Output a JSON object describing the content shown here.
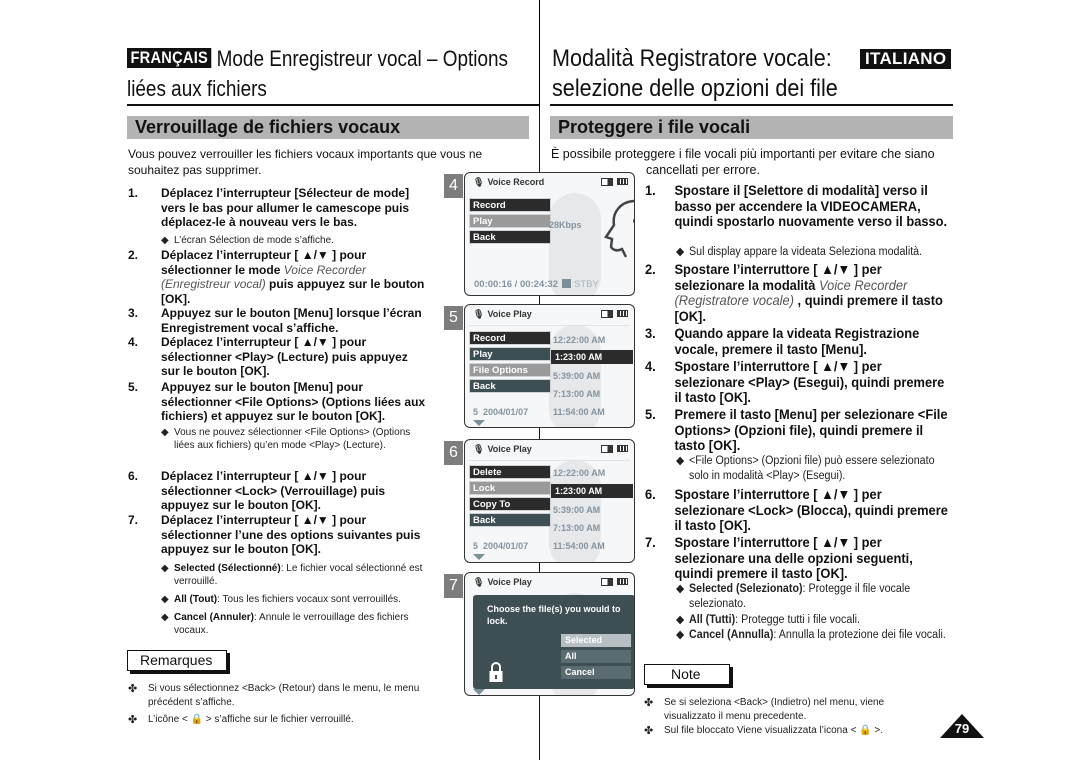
{
  "header": {
    "fr_badge": "FRANÇAIS",
    "fr_title_line1": "Mode Enregistreur vocal – Options",
    "fr_title_line2": "liées aux fichiers",
    "it_title_line1": "Modalità Registratore vocale:",
    "it_title_line2": "selezione delle opzioni dei file",
    "it_badge": "ITALIANO"
  },
  "french": {
    "section_title": "Verrouillage de fichiers vocaux",
    "intro": "Vous pouvez verrouiller les fichiers vocaux importants que vous ne souhaitez pas supprimer.",
    "steps": [
      {
        "num": "1.",
        "text": "Déplacez l’interrupteur [Sélecteur de mode] vers le bas pour allumer le camescope puis déplacez-le à nouveau vers le bas."
      },
      {
        "num": "2.",
        "text_a": "Déplacez l’interrupteur [ ▲/▼ ] pour sélectionner le mode ",
        "text_it": "Voice Recorder (Enregistreur vocal)",
        "text_b": " puis appuyez sur le bouton [OK]."
      },
      {
        "num": "3.",
        "text": "Appuyez sur le bouton [Menu] lorsque l’écran Enregistrement vocal s’affiche."
      },
      {
        "num": "4.",
        "text": "Déplacez l’interrupteur [ ▲/▼ ] pour sélectionner <Play> (Lecture) puis appuyez sur le bouton [OK]."
      },
      {
        "num": "5.",
        "text": "Appuyez sur le bouton [Menu] pour sélectionner <File Options> (Options liées aux fichiers) et appuyez sur le bouton [OK]."
      },
      {
        "num": "6.",
        "text": "Déplacez l’interrupteur [ ▲/▼ ] pour sélectionner <Lock> (Verrouillage) puis appuyez sur le bouton [OK]."
      },
      {
        "num": "7.",
        "text": "Déplacez l’interrupteur [ ▲/▼ ] pour sélectionner l’une des options suivantes puis appuyez sur le bouton [OK]."
      }
    ],
    "bullets": {
      "after_1": "L’écran Sélection de mode s’affiche.",
      "after_5": "Vous ne pouvez sélectionner <File Options> (Options liées aux fichiers) qu’en mode <Play> (Lecture).",
      "options": [
        {
          "term": "Selected (Sélectionné)",
          "desc": ": Le fichier vocal sélectionné est verrouillé."
        },
        {
          "term": "All (Tout)",
          "desc": ": Tous les fichiers vocaux sont verrouillés."
        },
        {
          "term": "Cancel (Annuler)",
          "desc": ": Annule le verrouillage des fichiers vocaux."
        }
      ]
    },
    "notes_label": "Remarques",
    "notes": [
      "Si vous sélectionnez <Back> (Retour) dans le menu, le menu précédent s’affiche.",
      "L’icône < 🔒 > s’affiche sur le fichier verrouillé."
    ]
  },
  "italian": {
    "section_title": "Proteggere i file vocali",
    "intro_line1": "È possibile proteggere i file vocali più importanti per evitare che siano",
    "intro_line2": "cancellati per errore.",
    "steps": [
      {
        "num": "1.",
        "text": "Spostare il [Selettore di modalità] verso il basso per accendere la VIDEOCAMERA, quindi spostarlo nuovamente verso il basso."
      },
      {
        "num": "2.",
        "text_a": "Spostare l’interruttore [ ▲/▼ ] per selezionare la modalità ",
        "text_it": "Voice Recorder (Registratore vocale)",
        "text_b": " , quindi premere il tasto [OK]."
      },
      {
        "num": "3.",
        "text": "Quando appare la videata Registrazione vocale, premere il tasto [Menu]."
      },
      {
        "num": "4.",
        "text": "Spostare l’interruttore [ ▲/▼ ] per selezionare <Play> (Esegui), quindi premere il tasto [OK]."
      },
      {
        "num": "5.",
        "text": "Premere il tasto [Menu] per selezionare <File Options> (Opzioni file), quindi premere il tasto [OK]."
      },
      {
        "num": "6.",
        "text": "Spostare l’interruttore [ ▲/▼ ] per selezionare <Lock> (Blocca), quindi premere il tasto [OK]."
      },
      {
        "num": "7.",
        "text": "Spostare l’interruttore [ ▲/▼ ] per selezionare una delle opzioni seguenti, quindi premere il tasto [OK]."
      }
    ],
    "bullets": {
      "after_1": "Sul display appare la videata Seleziona modalità.",
      "after_5": "<File Options> (Opzioni file) può essere selezionato solo in modalità <Play> (Esegui).",
      "options": [
        {
          "term": "Selected (Selezionato)",
          "desc": ": Protegge il file vocale selezionato."
        },
        {
          "term": "All (Tutti)",
          "desc": ": Protegge tutti i file vocali."
        },
        {
          "term": "Cancel (Annulla)",
          "desc": ": Annulla la protezione dei file vocali."
        }
      ]
    },
    "notes_label": "Note",
    "notes": [
      "Se si seleziona <Back> (Indietro) nel menu, viene visualizzato il menu precedente.",
      "Sul file bloccato Viene visualizzata l’icona < 🔒 >."
    ]
  },
  "screens": [
    {
      "step": "4",
      "title": "Voice Record",
      "menu": [
        "Record",
        "Play",
        "Back"
      ],
      "selected_menu": "Play",
      "bitrate_partial": "28Kbps",
      "timecode": "00:00:16 / 00:24:32",
      "status": "STBY"
    },
    {
      "step": "5",
      "title": "Voice Play",
      "menu": [
        "Record",
        "Play",
        "File Options",
        "Back"
      ],
      "selected_menu": "File Options",
      "times": [
        "12:22:00 AM",
        "1:23:00 AM",
        "5:39:00 AM",
        "7:13:00 AM",
        "11:54:00 AM"
      ],
      "selected_time": "1:23:00 AM",
      "last_row_index": "5",
      "last_row_date": "2004/01/07"
    },
    {
      "step": "6",
      "title": "Voice Play",
      "menu": [
        "Delete",
        "Lock",
        "Copy To",
        "Back"
      ],
      "selected_menu": "Lock",
      "times": [
        "12:22:00 AM",
        "1:23:00 AM",
        "5:39:00 AM",
        "7:13:00 AM",
        "11:54:00 AM"
      ],
      "selected_time": "1:23:00 AM",
      "last_row_index": "5",
      "last_row_date": "2004/01/07"
    },
    {
      "step": "7",
      "title": "Voice Play",
      "dialog_text": "Choose the file(s) you would to lock.",
      "options": [
        "Selected",
        "All",
        "Cancel"
      ],
      "selected_option": "Selected"
    }
  ],
  "page_number": "79"
}
